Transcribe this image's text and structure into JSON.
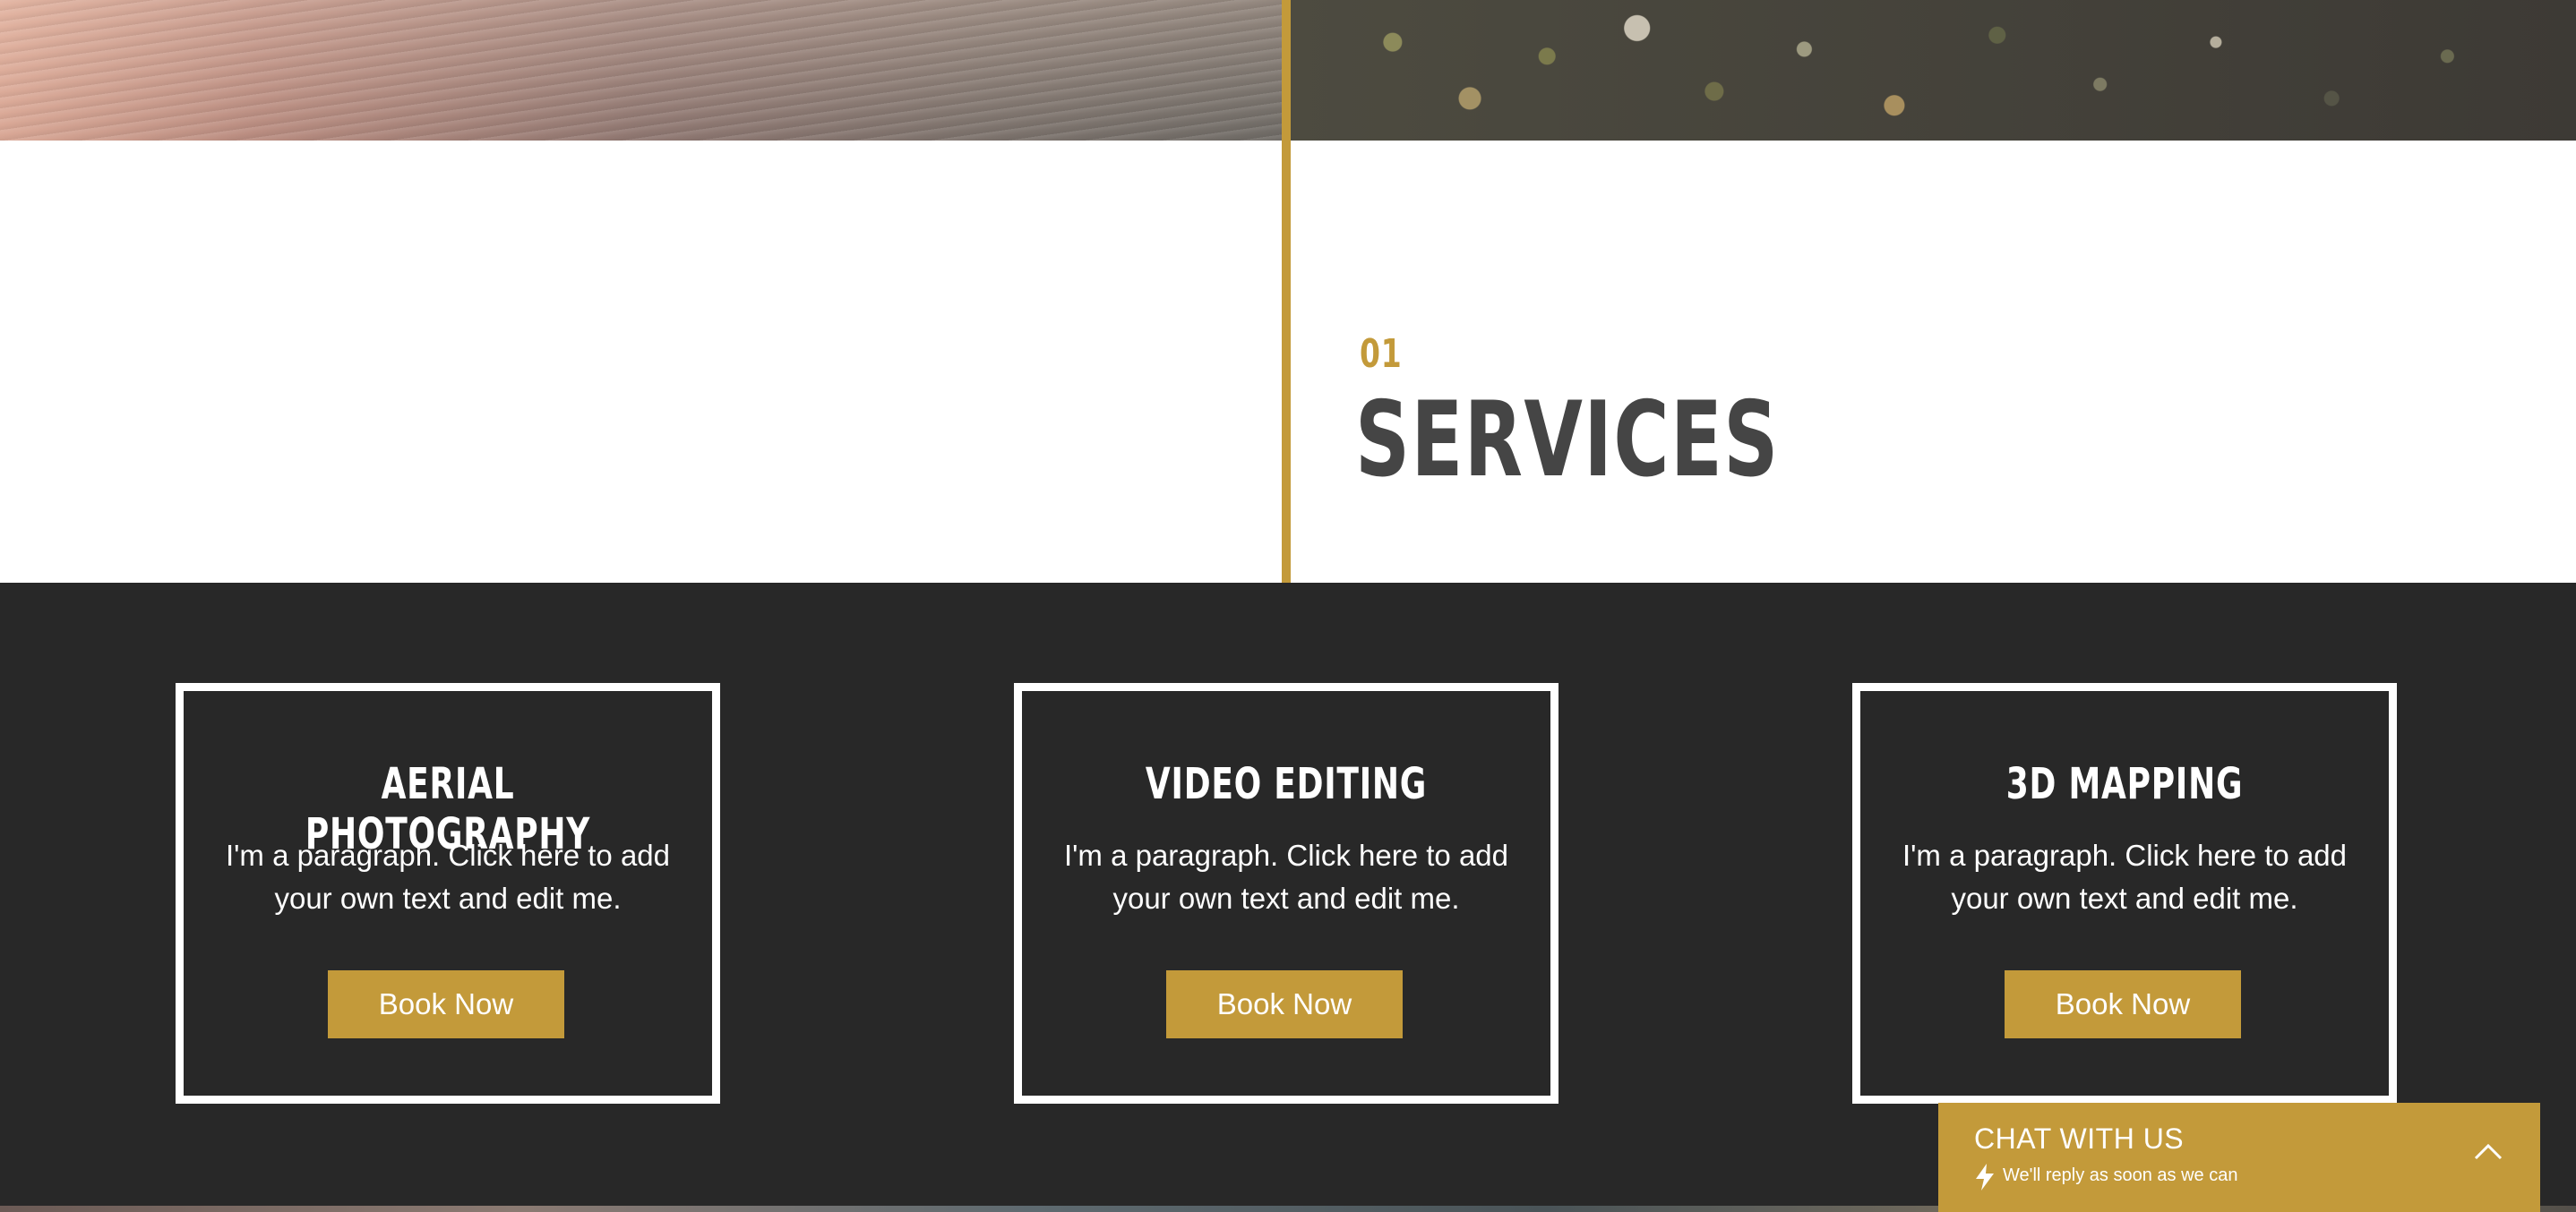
{
  "section": {
    "number": "01",
    "title": "SERVICES"
  },
  "services": [
    {
      "title": "AERIAL PHOTOGRAPHY",
      "text": "I'm a paragraph. Click here to add your own text and edit me.",
      "button": "Book Now"
    },
    {
      "title": "VIDEO EDITING",
      "text": "I'm a paragraph. Click here to add your own text and edit me.",
      "button": "Book Now"
    },
    {
      "title": "3D MAPPING",
      "text": "I'm a paragraph. Click here to add your own text and edit me.",
      "button": "Book Now"
    }
  ],
  "chat": {
    "title": "CHAT WITH US",
    "subtitle": "We'll reply as soon as we can",
    "icons": [
      "lightning-icon",
      "chevron-up-icon"
    ]
  },
  "colors": {
    "accent": "#c39a3a",
    "dark_bg": "#282828",
    "heading": "#454545"
  }
}
